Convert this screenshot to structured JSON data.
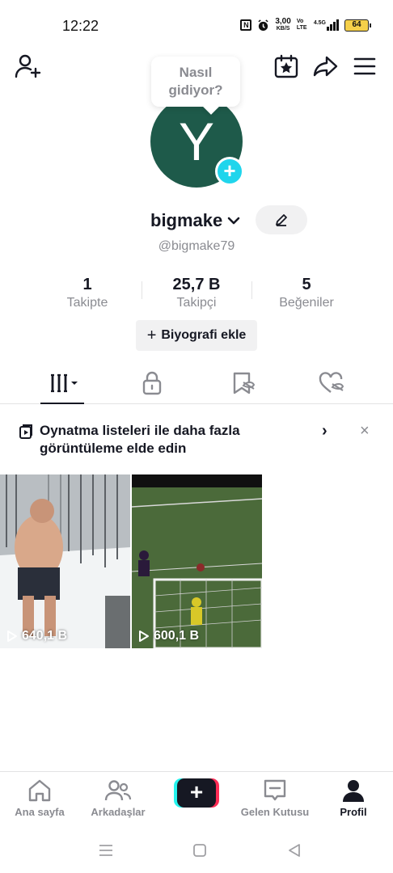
{
  "status_bar": {
    "time": "12:22",
    "nfc": "N",
    "speed_value": "3,00",
    "speed_unit": "KB/S",
    "volte": "Vo LTE",
    "network": "4.5G",
    "battery": "64"
  },
  "header": {
    "bubble_text": "Nasıl gidiyor?",
    "avatar_letter": "Y"
  },
  "profile": {
    "username": "bigmake",
    "handle": "@bigmake79",
    "bio_button": "Biyografi ekle"
  },
  "stats": [
    {
      "value": "1",
      "label": "Takipte"
    },
    {
      "value": "25,7 B",
      "label": "Takipçi"
    },
    {
      "value": "5",
      "label": "Beğeniler"
    }
  ],
  "playlist_banner": {
    "text": "Oynatma listeleri ile daha fazla görüntüleme elde edin",
    "chevron": "›",
    "close": "×"
  },
  "videos": [
    {
      "views": "640,1 B"
    },
    {
      "views": "600,1 B"
    }
  ],
  "bottom_nav": [
    {
      "label": "Ana sayfa",
      "icon": "home-icon"
    },
    {
      "label": "Arkadaşlar",
      "icon": "friends-icon"
    },
    {
      "label": "",
      "icon": "create-icon"
    },
    {
      "label": "Gelen Kutusu",
      "icon": "inbox-icon"
    },
    {
      "label": "Profil",
      "icon": "profile-icon"
    }
  ],
  "colors": {
    "accent_cyan": "#20d5ec",
    "accent_red": "#fe2c55",
    "avatar_bg": "#1e5a4a",
    "text_primary": "#161823",
    "text_secondary": "#8a8b91"
  }
}
